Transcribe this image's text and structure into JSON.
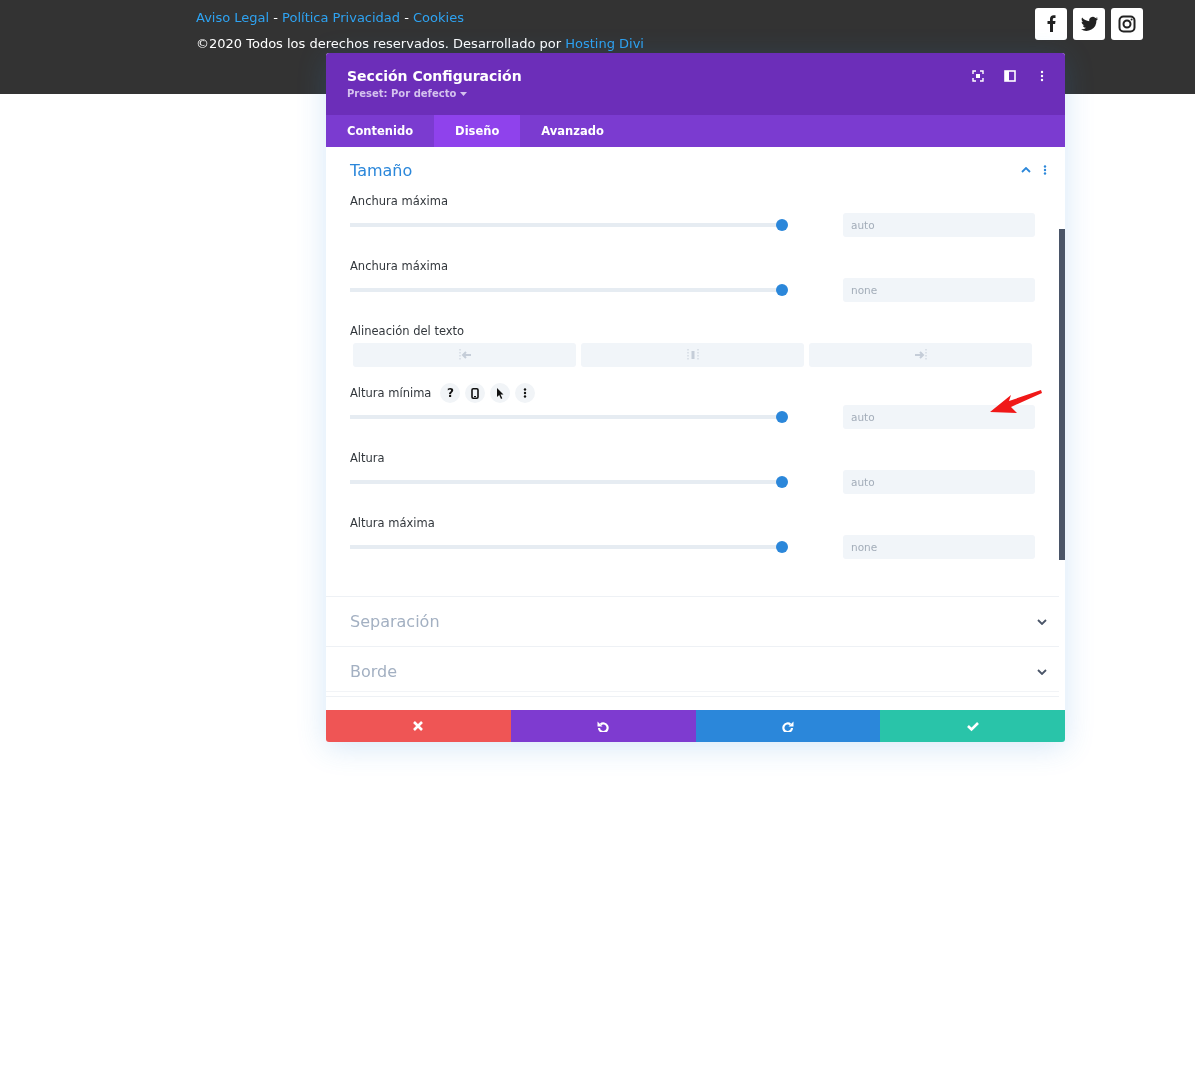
{
  "footer": {
    "links": [
      "Aviso Legal",
      "Política Privacidad",
      "Cookies"
    ],
    "separator": "-",
    "copyright": "©2020 Todos los derechos reservados. Desarrollado por",
    "credit_link": "Hosting Divi",
    "social": [
      {
        "kind": "facebook"
      },
      {
        "kind": "twitter"
      },
      {
        "kind": "instagram"
      }
    ]
  },
  "modal": {
    "title": "Sección Configuración",
    "preset": "Preset: Por defecto",
    "header_icons": [
      {
        "kind": "focus"
      },
      {
        "kind": "sidebar"
      },
      {
        "kind": "more"
      }
    ],
    "tabs": [
      {
        "label": "Contenido",
        "selected": false
      },
      {
        "label": "Diseño",
        "selected": true
      },
      {
        "label": "Avanzado",
        "selected": false
      }
    ],
    "sections": [
      {
        "title": "Tamaño",
        "expanded": true,
        "settings": [
          {
            "kind": "slider",
            "label": "Anchura máxima",
            "level": 1,
            "value": "auto"
          },
          {
            "kind": "slider",
            "label": "Anchura máxima",
            "level": 1,
            "value": "none"
          },
          {
            "kind": "align",
            "label": "Alineación del texto",
            "options": [
              {
                "kind": "left"
              },
              {
                "kind": "center"
              },
              {
                "kind": "right"
              }
            ]
          },
          {
            "kind": "slider",
            "label": "Altura mínima",
            "level": 1,
            "value": "auto",
            "tools": true,
            "help": "?"
          },
          {
            "kind": "slider",
            "label": "Altura",
            "level": 1,
            "value": "auto"
          },
          {
            "kind": "slider",
            "label": "Altura máxima",
            "level": 1,
            "value": "none"
          }
        ]
      },
      {
        "title": "Separación",
        "expanded": false
      },
      {
        "title": "Borde",
        "expanded": false
      }
    ],
    "actions": [
      {
        "kind": "cancel"
      },
      {
        "kind": "undo"
      },
      {
        "kind": "redo"
      },
      {
        "kind": "save"
      }
    ]
  }
}
